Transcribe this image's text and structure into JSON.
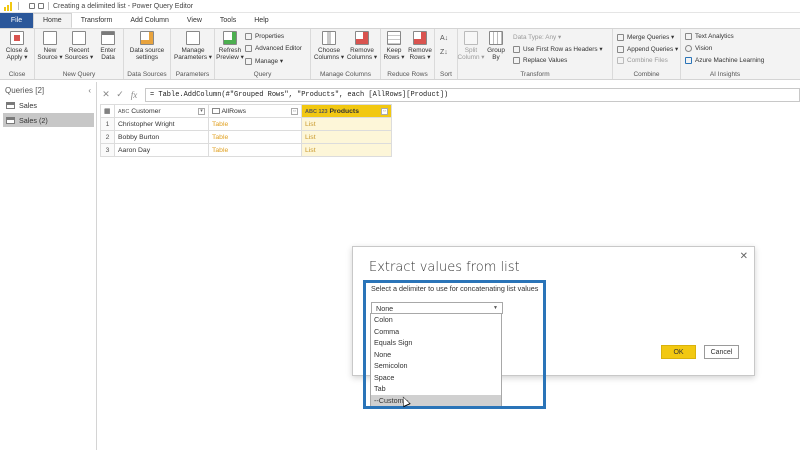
{
  "window": {
    "title": "Creating a delimited list - Power Query Editor"
  },
  "tabs": [
    "File",
    "Home",
    "Transform",
    "Add Column",
    "View",
    "Tools",
    "Help"
  ],
  "ribbon": {
    "close": {
      "close_apply": "Close &\nApply ▾",
      "label": "Close"
    },
    "new_query": {
      "new_source": "New\nSource ▾",
      "recent_sources": "Recent\nSources ▾",
      "enter_data": "Enter\nData",
      "label": "New Query"
    },
    "data_sources": {
      "settings": "Data source\nsettings",
      "label": "Data Sources"
    },
    "parameters": {
      "manage": "Manage\nParameters ▾",
      "label": "Parameters"
    },
    "query": {
      "refresh": "Refresh\nPreview ▾",
      "properties": "Properties",
      "advanced_editor": "Advanced Editor",
      "manage": "Manage ▾",
      "label": "Query"
    },
    "manage_columns": {
      "choose": "Choose\nColumns ▾",
      "remove": "Remove\nColumns ▾",
      "label": "Manage Columns"
    },
    "reduce_rows": {
      "keep": "Keep\nRows ▾",
      "remove": "Remove\nRows ▾",
      "label": "Reduce Rows"
    },
    "sort": {
      "label": "Sort"
    },
    "transform": {
      "split": "Split\nColumn ▾",
      "group": "Group\nBy",
      "data_type": "Data Type: Any ▾",
      "first_row": "Use First Row as Headers ▾",
      "replace": "Replace Values",
      "label": "Transform"
    },
    "combine": {
      "merge": "Merge Queries ▾",
      "append": "Append Queries ▾",
      "combine_files": "Combine Files",
      "label": "Combine"
    },
    "ai": {
      "text": "Text Analytics",
      "vision": "Vision",
      "azure": "Azure Machine Learning",
      "label": "AI Insights"
    }
  },
  "queries": {
    "header": "Queries [2]",
    "items": [
      {
        "label": "Sales",
        "selected": false
      },
      {
        "label": "Sales (2)",
        "selected": true
      }
    ]
  },
  "formula": "= Table.AddColumn(#\"Grouped Rows\", \"Products\", each [AllRows][Product])",
  "table": {
    "columns": [
      {
        "type": "ABC",
        "name": "Customer"
      },
      {
        "type": "",
        "name": "AllRows"
      },
      {
        "type": "ABC 123",
        "name": "Products"
      }
    ],
    "rows": [
      {
        "n": "1",
        "customer": "Christopher Wright",
        "allrows": "Table",
        "products": "List"
      },
      {
        "n": "2",
        "customer": "Bobby Burton",
        "allrows": "Table",
        "products": "List"
      },
      {
        "n": "3",
        "customer": "Aaron Day",
        "allrows": "Table",
        "products": "List"
      }
    ]
  },
  "dialog": {
    "title": "Extract values from list",
    "description": "Select a delimiter to use for concatenating list values",
    "selected": "None",
    "ok": "OK",
    "cancel": "Cancel",
    "options": [
      "Colon",
      "Comma",
      "Equals Sign",
      "None",
      "Semicolon",
      "Space",
      "Tab",
      "--Custom--"
    ],
    "hovered_option": "--Custom--"
  },
  "colors": {
    "accent": "#f2c811",
    "file_tab": "#2b579a",
    "highlight": "#2a74b8"
  }
}
